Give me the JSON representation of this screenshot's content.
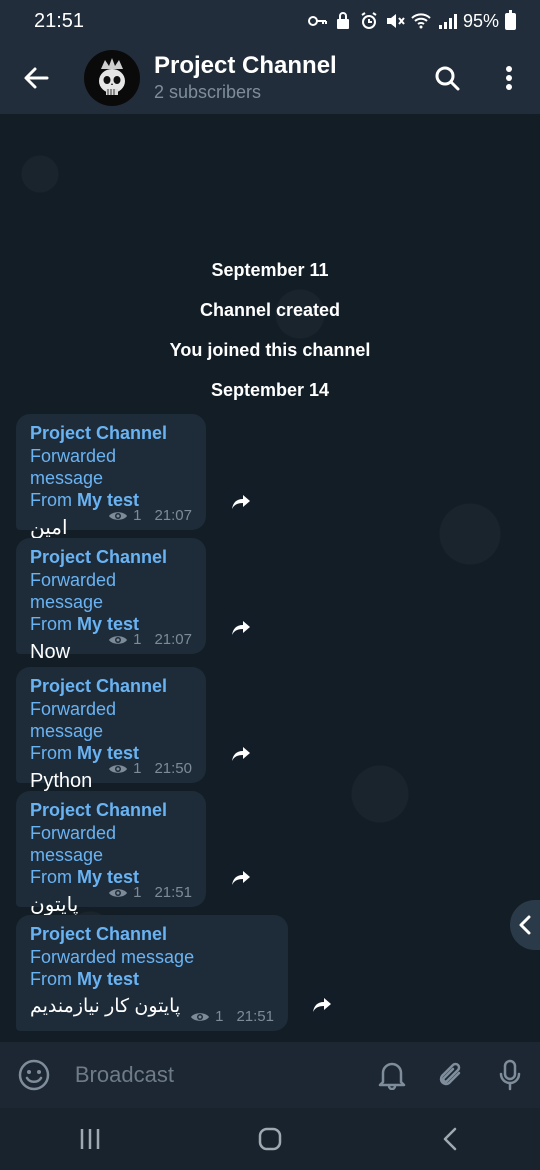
{
  "status_bar": {
    "time": "21:51",
    "battery": "95%",
    "icons": [
      "key-icon",
      "lock-icon",
      "alarm-icon",
      "mute-icon",
      "wifi-icon",
      "signal-icon",
      "battery-icon"
    ]
  },
  "header": {
    "title": "Project Channel",
    "subtitle": "2 subscribers",
    "back_icon": "arrow-left-icon",
    "search_icon": "search-icon",
    "menu_icon": "more-vertical-icon"
  },
  "service_messages": [
    "September 11",
    "Channel created",
    "You joined this channel",
    "September 14"
  ],
  "messages": [
    {
      "sender": "Project Channel",
      "forwarded": "Forwarded message",
      "from_prefix": "From ",
      "from_name": "My test",
      "text": "امين",
      "views": "1",
      "time": "21:07"
    },
    {
      "sender": "Project Channel",
      "forwarded": "Forwarded message",
      "from_prefix": "From ",
      "from_name": "My test",
      "text": "Now",
      "views": "1",
      "time": "21:07"
    },
    {
      "sender": "Project Channel",
      "forwarded": "Forwarded message",
      "from_prefix": "From ",
      "from_name": "My test",
      "text": "Python",
      "views": "1",
      "time": "21:50"
    },
    {
      "sender": "Project Channel",
      "forwarded": "Forwarded message",
      "from_prefix": "From ",
      "from_name": "My test",
      "text": "پایتون",
      "views": "1",
      "time": "21:51"
    },
    {
      "sender": "Project Channel",
      "forwarded": "Forwarded message",
      "from_prefix": "From ",
      "from_name": "My test",
      "text": "پایتون کار نیازمندیم",
      "views": "1",
      "time": "21:51"
    }
  ],
  "input": {
    "placeholder": "Broadcast",
    "value": ""
  },
  "colors": {
    "accent": "#6ab3f3",
    "header_bg": "#212d3b",
    "bubble_bg": "#1e2c3a",
    "chat_bg": "#121d26"
  }
}
